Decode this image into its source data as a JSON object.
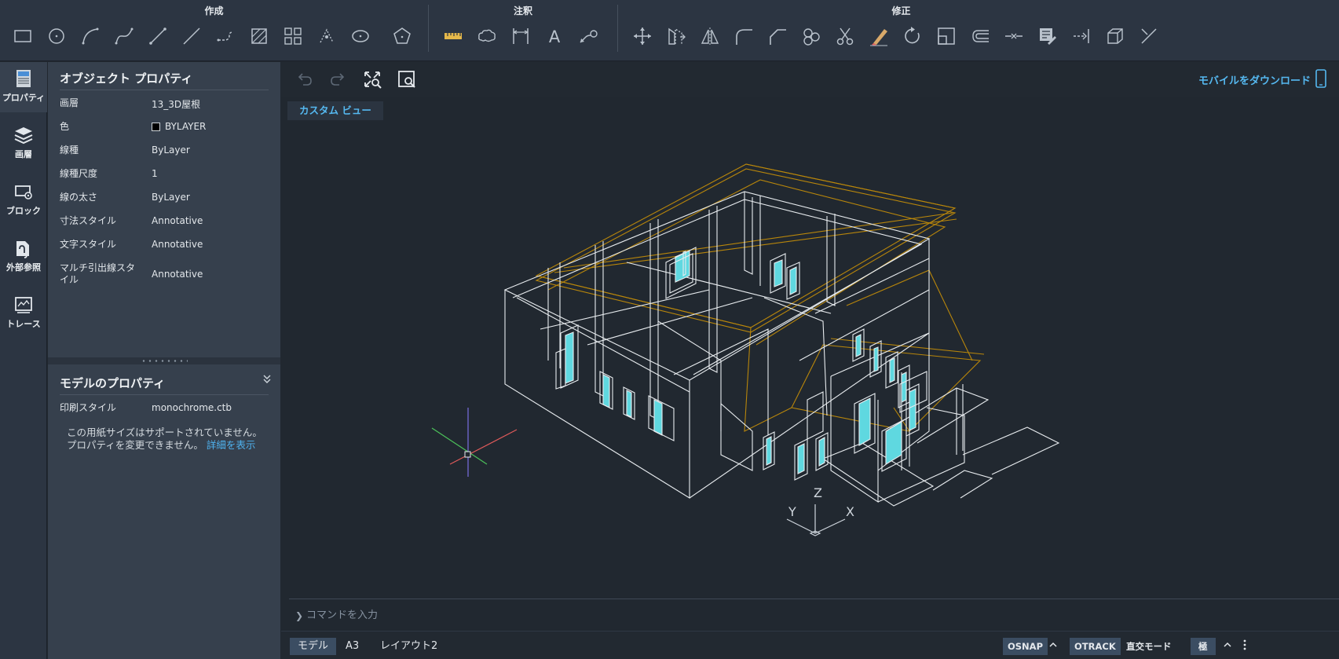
{
  "toolbar": {
    "groups": [
      {
        "title": "作成",
        "tools": [
          "rectangle-icon",
          "circle-icon",
          "arc-icon",
          "spline-icon",
          "line-icon",
          "construction-line-icon",
          "polyline-icon",
          "hatch-icon",
          "array-icon",
          "point-icon",
          "ellipse-icon",
          "polygon-icon"
        ]
      },
      {
        "title": "注釈",
        "tools": [
          "measure-icon",
          "revision-cloud-icon",
          "dimension-icon",
          "text-icon",
          "leader-icon"
        ]
      },
      {
        "title": "修正",
        "tools": [
          "move-icon",
          "copy-icon",
          "mirror-icon",
          "fillet-icon",
          "chamfer-icon",
          "join-icon",
          "trim-icon",
          "erase-icon",
          "rotate-icon",
          "scale-icon",
          "offset-icon",
          "break-icon",
          "match-properties-icon",
          "extend-icon",
          "box-icon",
          "explode-icon"
        ]
      }
    ]
  },
  "rail": {
    "items": [
      {
        "label": "プロパティ",
        "icon": "properties-icon"
      },
      {
        "label": "画層",
        "icon": "layers-icon"
      },
      {
        "label": "ブロック",
        "icon": "block-icon"
      },
      {
        "label": "外部参照",
        "icon": "xref-icon"
      },
      {
        "label": "トレース",
        "icon": "trace-icon"
      }
    ]
  },
  "object_properties": {
    "title": "オブジェクト プロパティ",
    "rows": [
      {
        "name": "画層",
        "value": "13_3D屋根"
      },
      {
        "name": "色",
        "value": "BYLAYER"
      },
      {
        "name": "線種",
        "value": "ByLayer"
      },
      {
        "name": "線種尺度",
        "value": "1"
      },
      {
        "name": "線の太さ",
        "value": "ByLayer"
      },
      {
        "name": "寸法スタイル",
        "value": "Annotative"
      },
      {
        "name": "文字スタイル",
        "value": "Annotative"
      },
      {
        "name": "マルチ引出線スタイル",
        "value": "Annotative"
      }
    ],
    "color_swatch": "#000000"
  },
  "model_properties": {
    "title": "モデルのプロパティ",
    "rows": [
      {
        "name": "印刷スタイル",
        "value": "monochrome.ctb"
      }
    ],
    "note": "この用紙サイズはサポートされていません。プロパティを変更できません。",
    "details_link": "詳細を表示"
  },
  "canvas": {
    "mobile_link": "モバイルをダウンロード",
    "view_label": "カスタム ビュー",
    "ucs_labels": {
      "x": "X",
      "y": "Y",
      "z": "Z"
    }
  },
  "command": {
    "placeholder": "コマンドを入力"
  },
  "layout_tabs": [
    {
      "label": "モデル",
      "active": true
    },
    {
      "label": "A3",
      "active": false
    },
    {
      "label": "レイアウト2",
      "active": false
    }
  ],
  "status": {
    "osnap": "OSNAP",
    "otrack": "OTRACK",
    "ortho": "直交モード",
    "polar": "極"
  },
  "colors": {
    "accent": "#55b8f0",
    "wire": "#e8ecef",
    "roof": "#b8860b",
    "glass": "#5fd8e0"
  }
}
